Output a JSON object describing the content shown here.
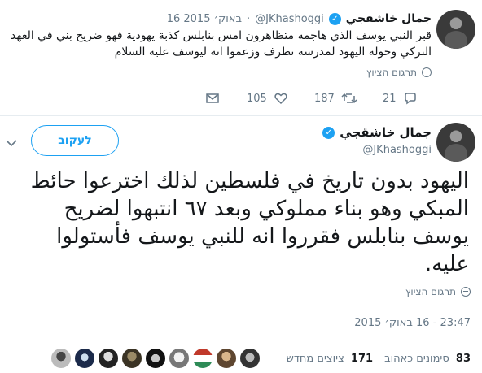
{
  "tweet1": {
    "name": "جمال خاشقجي",
    "handle": "@JKhashoggi",
    "dot": "·",
    "date": "16 באוק׳ 2015",
    "text": "قبر النبي يوسف الذي هاجمه متظاهرون امس بنابلس كذبة يهودية فهو ضريح بني في العهد التركي وحوله اليهود لمدرسة تطرف وزعموا انه ليوسف عليه السلام",
    "translate": "תרגום הציוץ",
    "replies": "",
    "retweets": "187",
    "likes": "105",
    "reply_count": "21"
  },
  "main": {
    "name": "جمال خاشقجي",
    "handle": "@JKhashoggi",
    "follow_label": "לעקוב",
    "text": "اليهود بدون تاريخ في فلسطين لذلك اخترعوا حائط المبكي وهو بناء مملوكي وبعد ٦٧ انتبهوا لضريح يوسف بنابلس فقرروا انه للنبي يوسف فأستولوا عليه.",
    "translate": "תרגום הציוץ",
    "timestamp": "23:47 - 16 באוק׳ 2015",
    "retweets_count": "171",
    "retweets_label": "ציוצים מחדש",
    "likes_count": "83",
    "likes_label": "סימונים כאהוב"
  },
  "colors": {
    "accent": "#1da1f2",
    "muted": "#657786",
    "text": "#14171a"
  },
  "icons": [
    "verified-icon",
    "globe-icon",
    "reply-icon",
    "retweet-icon",
    "heart-icon",
    "dm-icon",
    "chevron-down-icon"
  ]
}
